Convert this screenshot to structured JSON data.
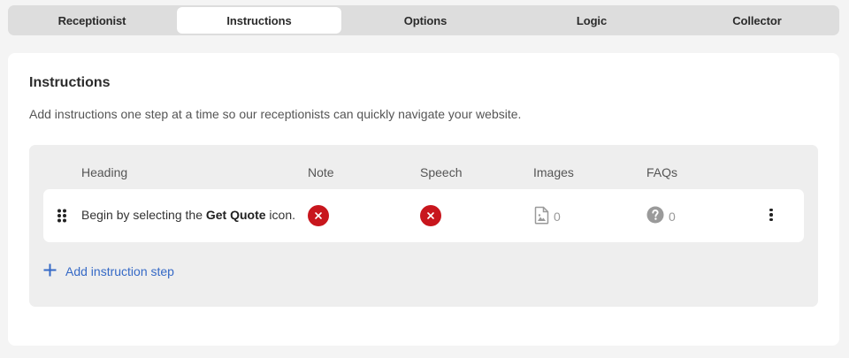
{
  "tabs": [
    {
      "label": "Receptionist",
      "active": false
    },
    {
      "label": "Instructions",
      "active": true
    },
    {
      "label": "Options",
      "active": false
    },
    {
      "label": "Logic",
      "active": false
    },
    {
      "label": "Collector",
      "active": false
    }
  ],
  "section": {
    "title": "Instructions",
    "description": "Add instructions one step at a time so our receptionists can quickly navigate your website."
  },
  "table": {
    "columns": [
      "Heading",
      "Note",
      "Speech",
      "Images",
      "FAQs"
    ],
    "rows": [
      {
        "heading_prefix": "Begin by selecting the ",
        "heading_bold": "Get Quote",
        "heading_suffix": " icon.",
        "note_icon": "x-circle-icon",
        "speech_icon": "x-circle-icon",
        "images_count": "0",
        "faqs_count": "0"
      }
    ]
  },
  "add_step_label": "Add instruction step",
  "colors": {
    "accent": "#3569c6",
    "error": "#c8161d",
    "muted_icon": "#9a9a9a"
  }
}
